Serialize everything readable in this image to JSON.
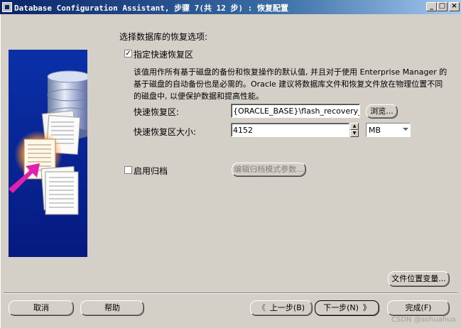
{
  "window": {
    "title": "Database Configuration Assistant, 步骤 7(共 12 步) : 恢复配置",
    "min": "_",
    "max": "□",
    "close": "×"
  },
  "main": {
    "section_label": "选择数据库的恢复选项:",
    "quick_recovery": {
      "checked": true,
      "check_mark": "✓",
      "label": "指定快速恢复区"
    },
    "description": "该值用作所有基于磁盘的备份和恢复操作的默认值, 并且对于使用 Enterprise Manager 的基于磁盘的自动备份也是必需的。Oracle 建议将数据库文件和恢复文件放在物理位置不同的磁盘中, 以便保护数据和提高性能。",
    "recovery_area": {
      "label": "快速恢复区:",
      "value": "{ORACLE_BASE}\\flash_recovery_area",
      "browse_label": "浏览..."
    },
    "recovery_size": {
      "label": "快速恢复区大小:",
      "value": "4152",
      "unit": "MB",
      "spin_up": "▲",
      "spin_down": "▼"
    },
    "archive": {
      "checked": false,
      "check_mark": "",
      "label": "启用归档",
      "edit_params_label": "编辑归档模式参数..."
    },
    "file_location_label": "文件位置变量..."
  },
  "footer": {
    "cancel": "取消",
    "help": "帮助",
    "back": "上一步(B)",
    "next": "下一步(N)",
    "finish": "完成(F)",
    "back_arrow": "《",
    "next_arrow": "》"
  },
  "watermark": "CSDN @sohuahua",
  "colors": {
    "dialog_bg": "#d4d0c8",
    "titlebar_start": "#0a246a",
    "panel_blue": "#0a30a8",
    "arrow_magenta": "#e020b0"
  }
}
